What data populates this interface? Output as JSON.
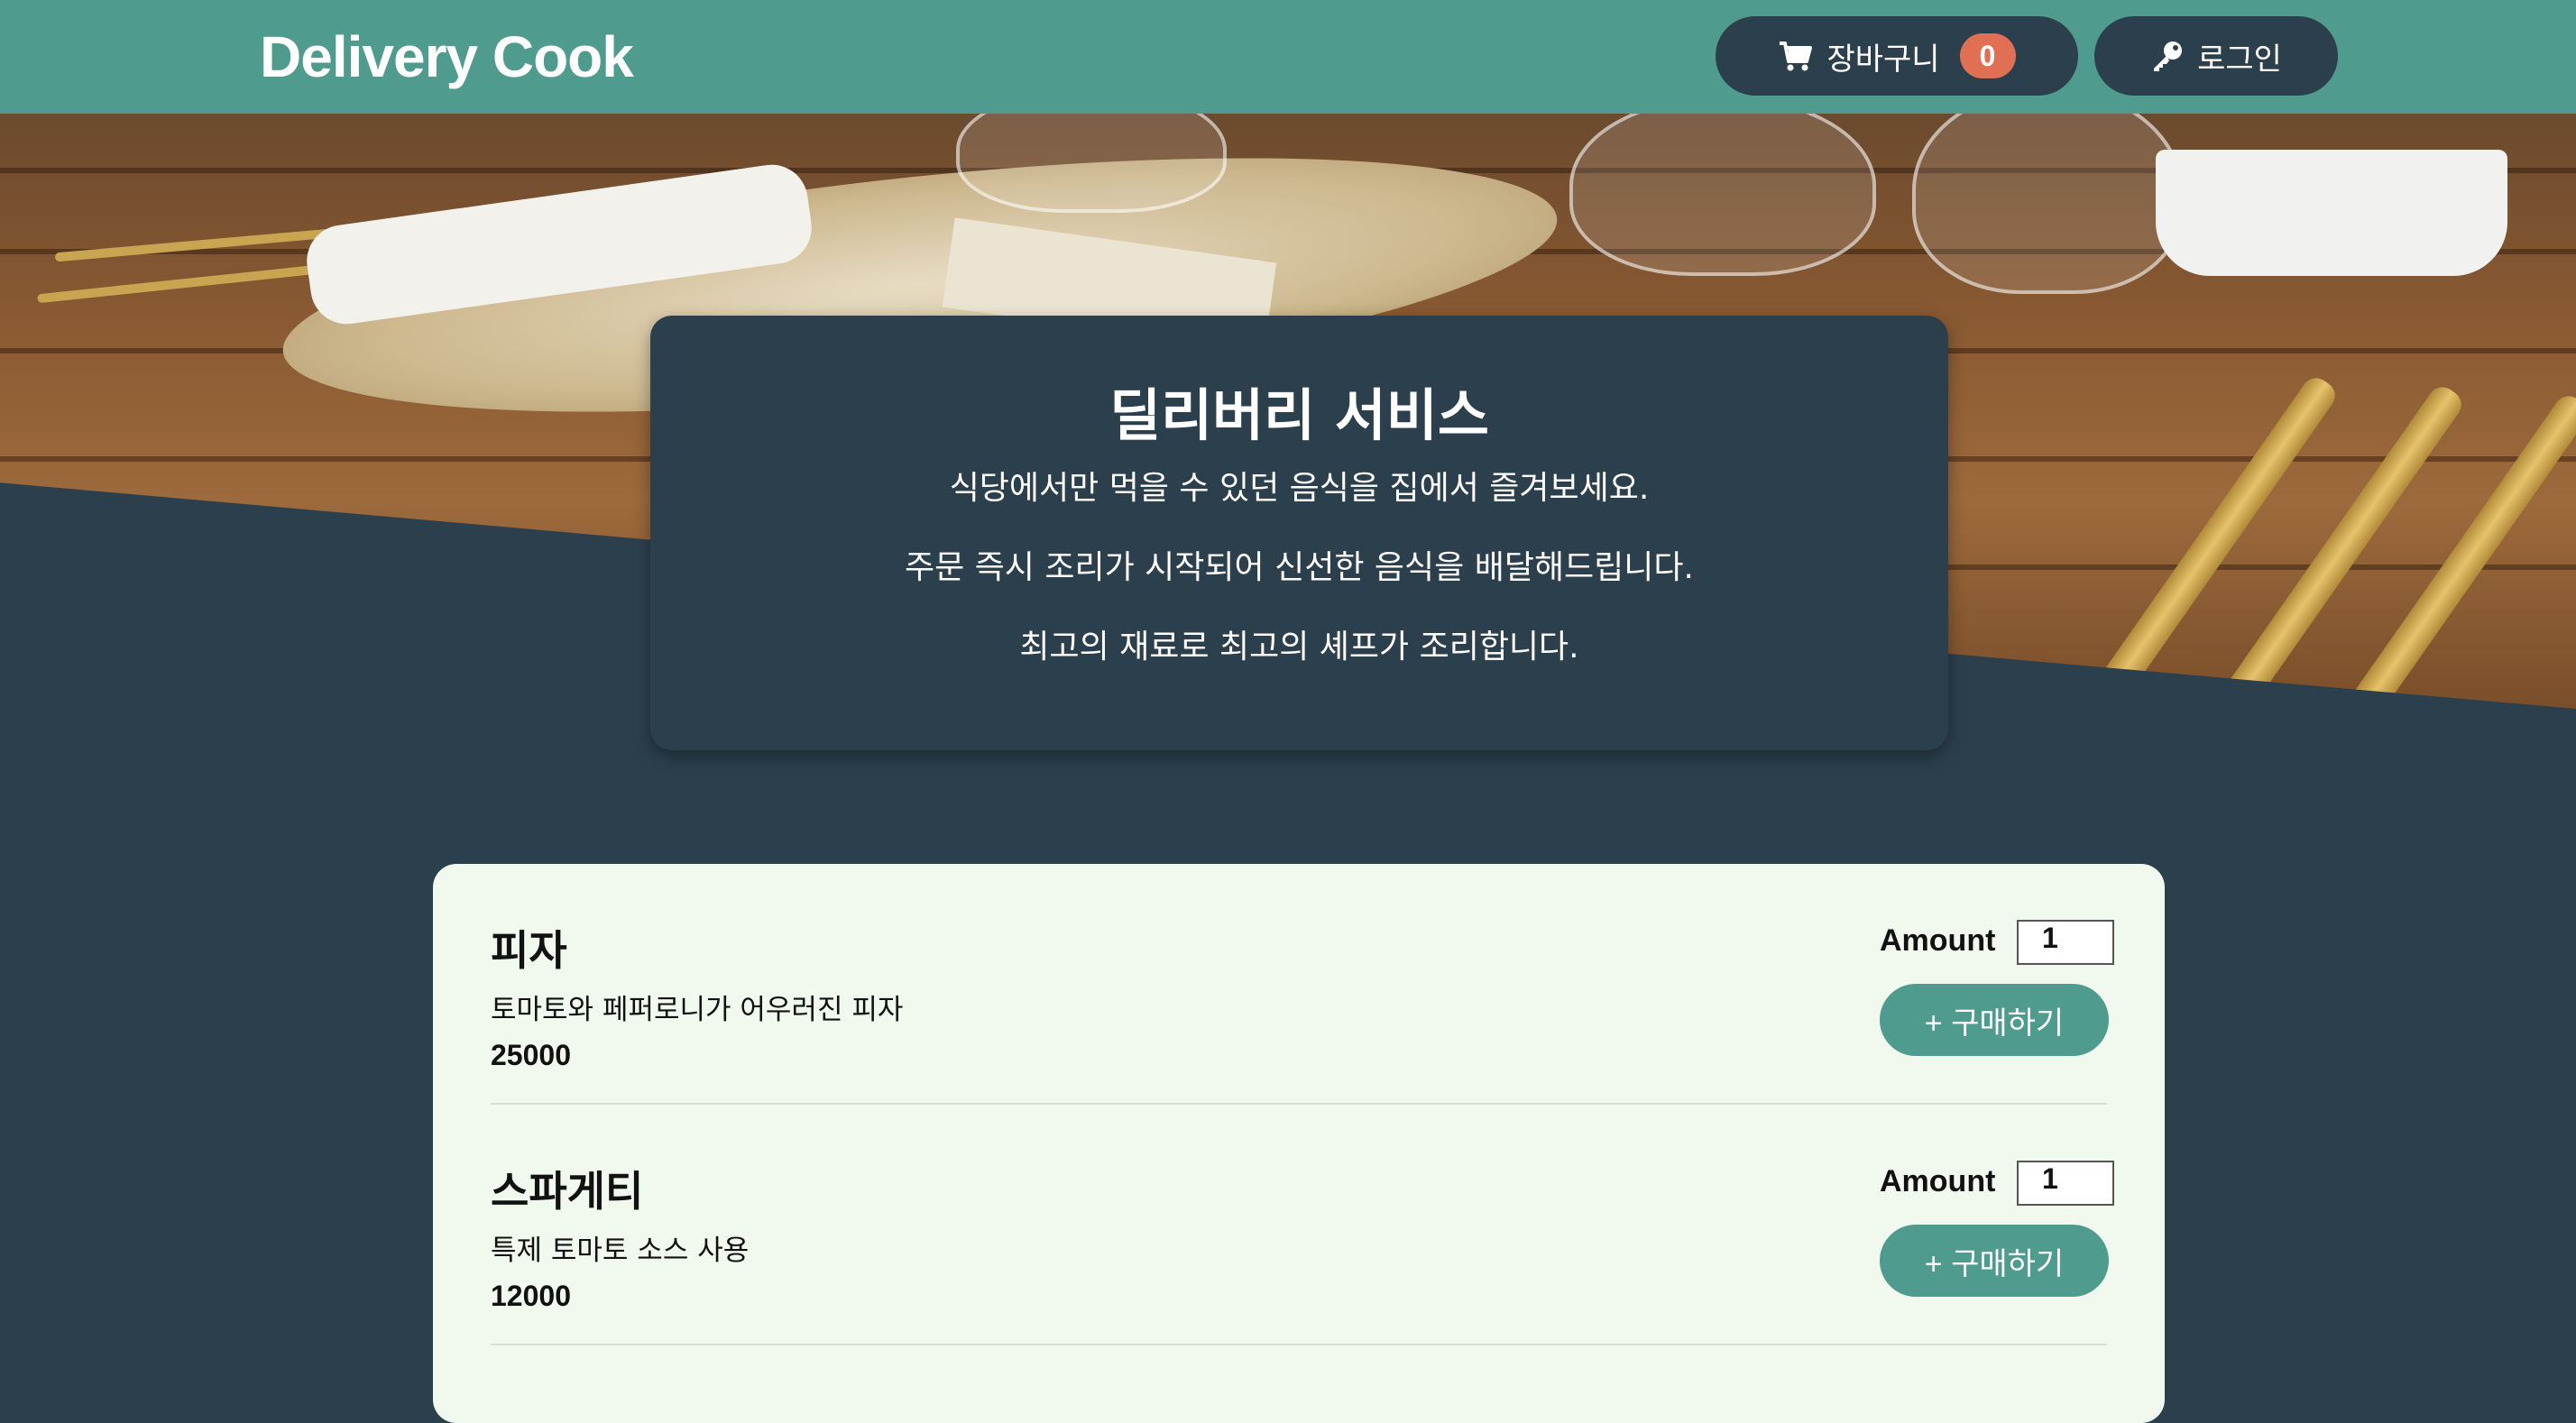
{
  "header": {
    "logo": "Delivery Cook",
    "cart_label": "장바구니",
    "cart_count": "0",
    "login_label": "로그인"
  },
  "intro": {
    "title": "딜리버리 서비스",
    "lines": [
      "식당에서만 먹을 수 있던 음식을 집에서 즐겨보세요.",
      "주문 즉시 조리가 시작되어 신선한 음식을 배달해드립니다.",
      "최고의 재료로 최고의 셰프가 조리합니다."
    ]
  },
  "menu": {
    "items": [
      {
        "name": "피자",
        "description": "토마토와 페퍼로니가 어우러진 피자",
        "price": "25000",
        "amount_label": "Amount",
        "amount_value": "1",
        "buy_label": "+ 구매하기"
      },
      {
        "name": "스파게티",
        "description": "특제 토마토 소스 사용",
        "price": "12000",
        "amount_label": "Amount",
        "amount_value": "1",
        "buy_label": "+ 구매하기"
      }
    ]
  },
  "colors": {
    "header_bg": "#4f9b8e",
    "dark_bg": "#2b3f4d",
    "badge": "#e06f54",
    "card_bg": "#f1f9ef"
  }
}
